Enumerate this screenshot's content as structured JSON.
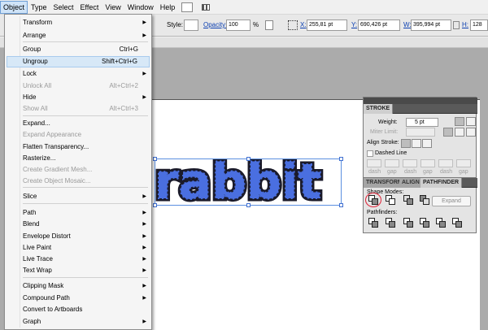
{
  "menubar": {
    "items": [
      "Object",
      "Type",
      "Select",
      "Effect",
      "View",
      "Window",
      "Help"
    ]
  },
  "controlbar": {
    "style_label": "Style:",
    "opacity_label": "Opacity:",
    "opacity_value": "100",
    "opacity_unit": "%",
    "x_label": "X:",
    "x_value": "255,81 pt",
    "y_label": "Y:",
    "y_value": "690,426 pt",
    "w_label": "W:",
    "w_value": "395,994 pt",
    "h_label": "H:",
    "h_value": "128"
  },
  "object_menu": {
    "items": [
      {
        "label": "Transform",
        "shortcut": "",
        "submenu": true,
        "disabled": false
      },
      {
        "label": "Arrange",
        "shortcut": "",
        "submenu": true,
        "disabled": false
      },
      {
        "label": "Group",
        "shortcut": "Ctrl+G",
        "submenu": false,
        "disabled": false
      },
      {
        "label": "Ungroup",
        "shortcut": "Shift+Ctrl+G",
        "submenu": false,
        "disabled": false,
        "hover": true
      },
      {
        "label": "Lock",
        "shortcut": "",
        "submenu": true,
        "disabled": false
      },
      {
        "label": "Unlock All",
        "shortcut": "Alt+Ctrl+2",
        "submenu": false,
        "disabled": true
      },
      {
        "label": "Hide",
        "shortcut": "",
        "submenu": true,
        "disabled": false
      },
      {
        "label": "Show All",
        "shortcut": "Alt+Ctrl+3",
        "submenu": false,
        "disabled": true
      },
      {
        "label": "Expand...",
        "shortcut": "",
        "submenu": false,
        "disabled": false
      },
      {
        "label": "Expand Appearance",
        "shortcut": "",
        "submenu": false,
        "disabled": true
      },
      {
        "label": "Flatten Transparency...",
        "shortcut": "",
        "submenu": false,
        "disabled": false
      },
      {
        "label": "Rasterize...",
        "shortcut": "",
        "submenu": false,
        "disabled": false
      },
      {
        "label": "Create Gradient Mesh...",
        "shortcut": "",
        "submenu": false,
        "disabled": true
      },
      {
        "label": "Create Object Mosaic...",
        "shortcut": "",
        "submenu": false,
        "disabled": true
      },
      {
        "label": "Slice",
        "shortcut": "",
        "submenu": true,
        "disabled": false
      },
      {
        "label": "Path",
        "shortcut": "",
        "submenu": true,
        "disabled": false
      },
      {
        "label": "Blend",
        "shortcut": "",
        "submenu": true,
        "disabled": false
      },
      {
        "label": "Envelope Distort",
        "shortcut": "",
        "submenu": true,
        "disabled": false
      },
      {
        "label": "Live Paint",
        "shortcut": "",
        "submenu": true,
        "disabled": false
      },
      {
        "label": "Live Trace",
        "shortcut": "",
        "submenu": true,
        "disabled": false
      },
      {
        "label": "Text Wrap",
        "shortcut": "",
        "submenu": true,
        "disabled": false
      },
      {
        "label": "Clipping Mask",
        "shortcut": "",
        "submenu": true,
        "disabled": false
      },
      {
        "label": "Compound Path",
        "shortcut": "",
        "submenu": true,
        "disabled": false
      },
      {
        "label": "Convert to Artboards",
        "shortcut": "",
        "submenu": false,
        "disabled": false
      },
      {
        "label": "Graph",
        "shortcut": "",
        "submenu": true,
        "disabled": false
      }
    ]
  },
  "artwork": {
    "text": "rabbit",
    "fill_color": "#4a6fe0",
    "outline_color": "#1a1a2a"
  },
  "stroke_panel": {
    "tab": "STROKE",
    "weight_label": "Weight:",
    "weight_value": "5 pt",
    "miter_label": "Miter Limit:",
    "align_label": "Align Stroke:",
    "dashed_label": "Dashed Line",
    "dash_labels": [
      "dash",
      "gap",
      "dash",
      "gap",
      "dash",
      "gap"
    ]
  },
  "pathfinder_panel": {
    "tabs": [
      "TRANSFORM",
      "ALIGN",
      "PATHFINDER"
    ],
    "shape_modes_label": "Shape Modes:",
    "expand_label": "Expand",
    "pathfinders_label": "Pathfinders:",
    "highlight_color": "#e0253a"
  }
}
